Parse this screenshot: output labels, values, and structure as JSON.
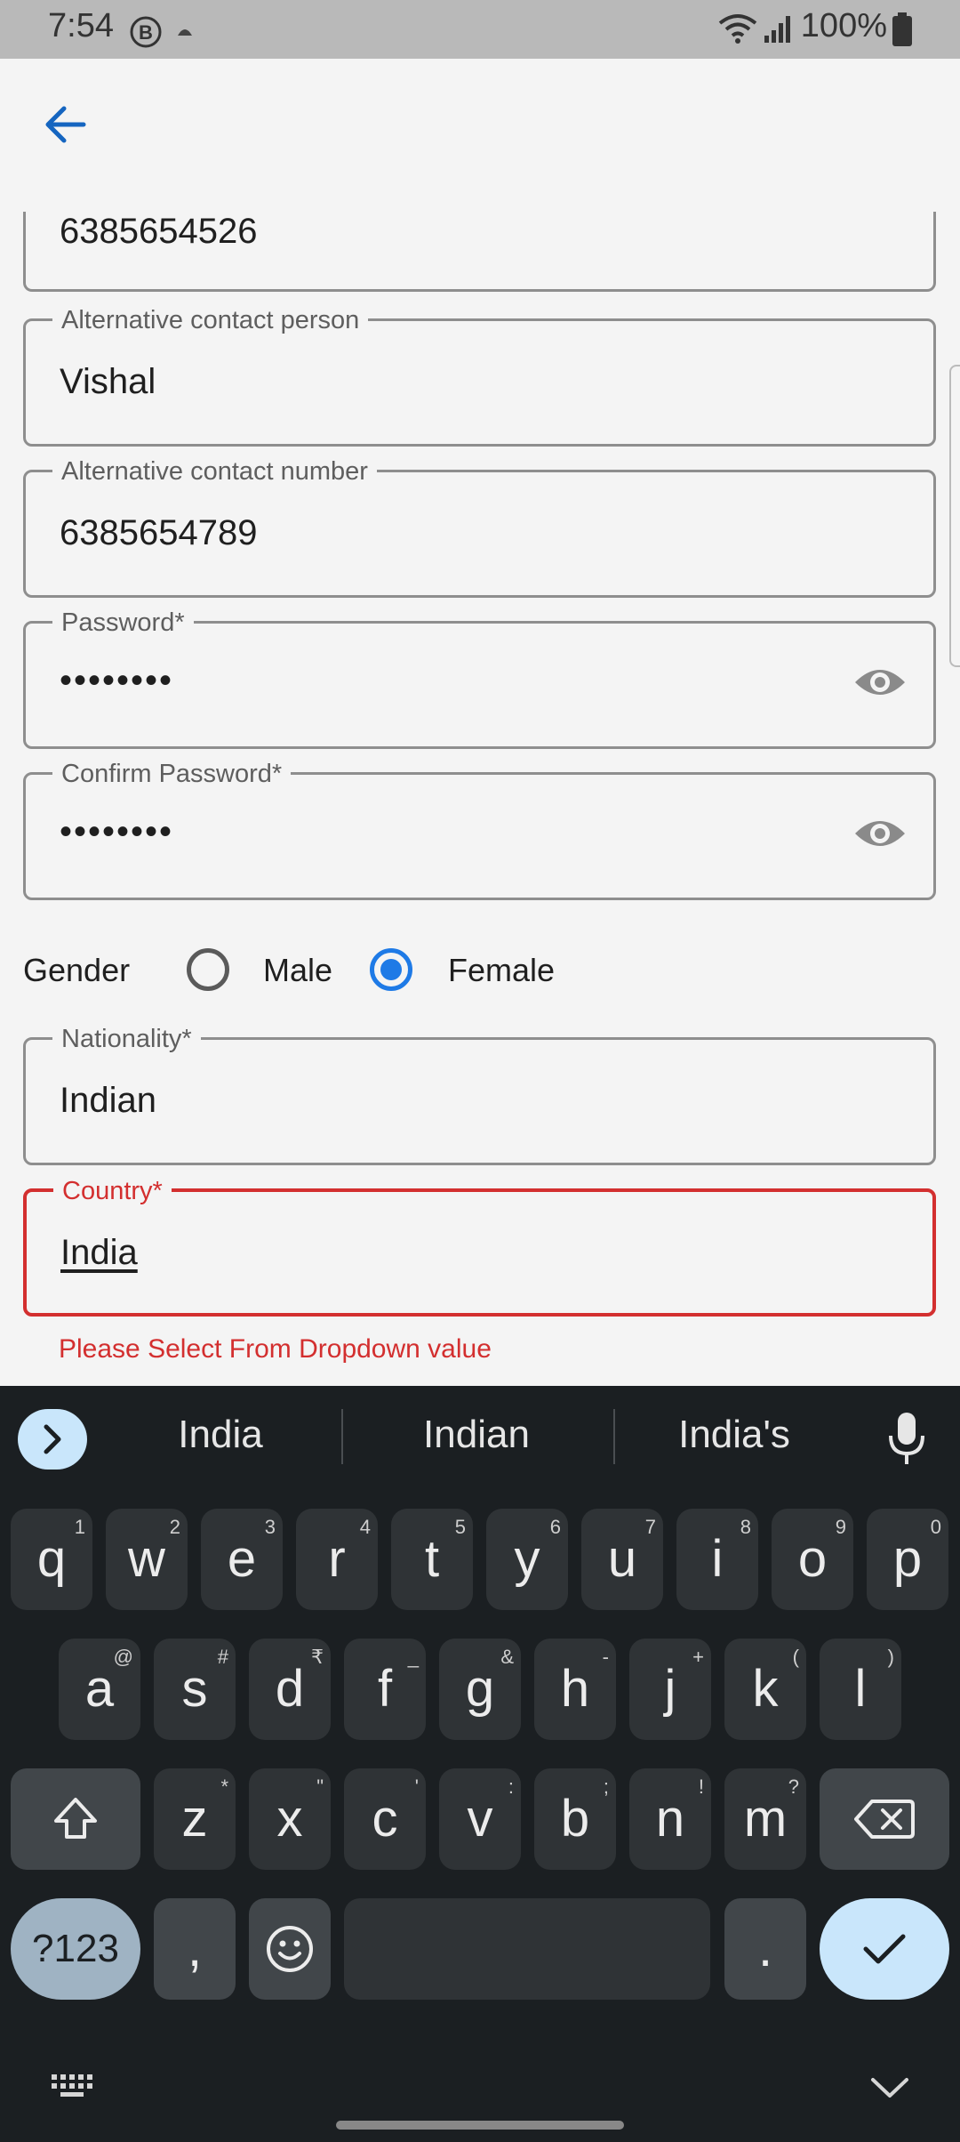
{
  "status_bar": {
    "time": "7:54",
    "battery": "100%"
  },
  "form": {
    "contact_number": {
      "value": "6385654526"
    },
    "alt_contact_person": {
      "label": "Alternative contact person",
      "value": "Vishal"
    },
    "alt_contact_number": {
      "label": "Alternative contact number",
      "value": "6385654789"
    },
    "password": {
      "label": "Password*",
      "value": "••••••••"
    },
    "confirm_password": {
      "label": "Confirm Password*",
      "value": "••••••••"
    },
    "gender": {
      "label": "Gender",
      "options": [
        "Male",
        "Female"
      ],
      "selected": "Female"
    },
    "nationality": {
      "label": "Nationality*",
      "value": "Indian"
    },
    "country": {
      "label": "Country*",
      "value": "India",
      "error": "Please Select From Dropdown value"
    }
  },
  "keyboard": {
    "suggestions": [
      "India",
      "Indian",
      "India's"
    ],
    "row1": [
      [
        "q",
        "1"
      ],
      [
        "w",
        "2"
      ],
      [
        "e",
        "3"
      ],
      [
        "r",
        "4"
      ],
      [
        "t",
        "5"
      ],
      [
        "y",
        "6"
      ],
      [
        "u",
        "7"
      ],
      [
        "i",
        "8"
      ],
      [
        "o",
        "9"
      ],
      [
        "p",
        "0"
      ]
    ],
    "row2": [
      [
        "a",
        "@"
      ],
      [
        "s",
        "#"
      ],
      [
        "d",
        "₹"
      ],
      [
        "f",
        "_"
      ],
      [
        "g",
        "&"
      ],
      [
        "h",
        "-"
      ],
      [
        "j",
        "+"
      ],
      [
        "k",
        "("
      ],
      [
        "l",
        ")"
      ]
    ],
    "row3": [
      [
        "z",
        "*"
      ],
      [
        "x",
        "\""
      ],
      [
        "c",
        "'"
      ],
      [
        "v",
        ":"
      ],
      [
        "b",
        ";"
      ],
      [
        "n",
        "!"
      ],
      [
        "m",
        "?"
      ]
    ],
    "sym_label": "?123",
    "comma": ",",
    "period": "."
  },
  "colors": {
    "accent": "#1e7ae6",
    "error": "#d32f2f",
    "keyboard_bg": "#1b1f22",
    "enter_key": "#c9e6fb"
  }
}
